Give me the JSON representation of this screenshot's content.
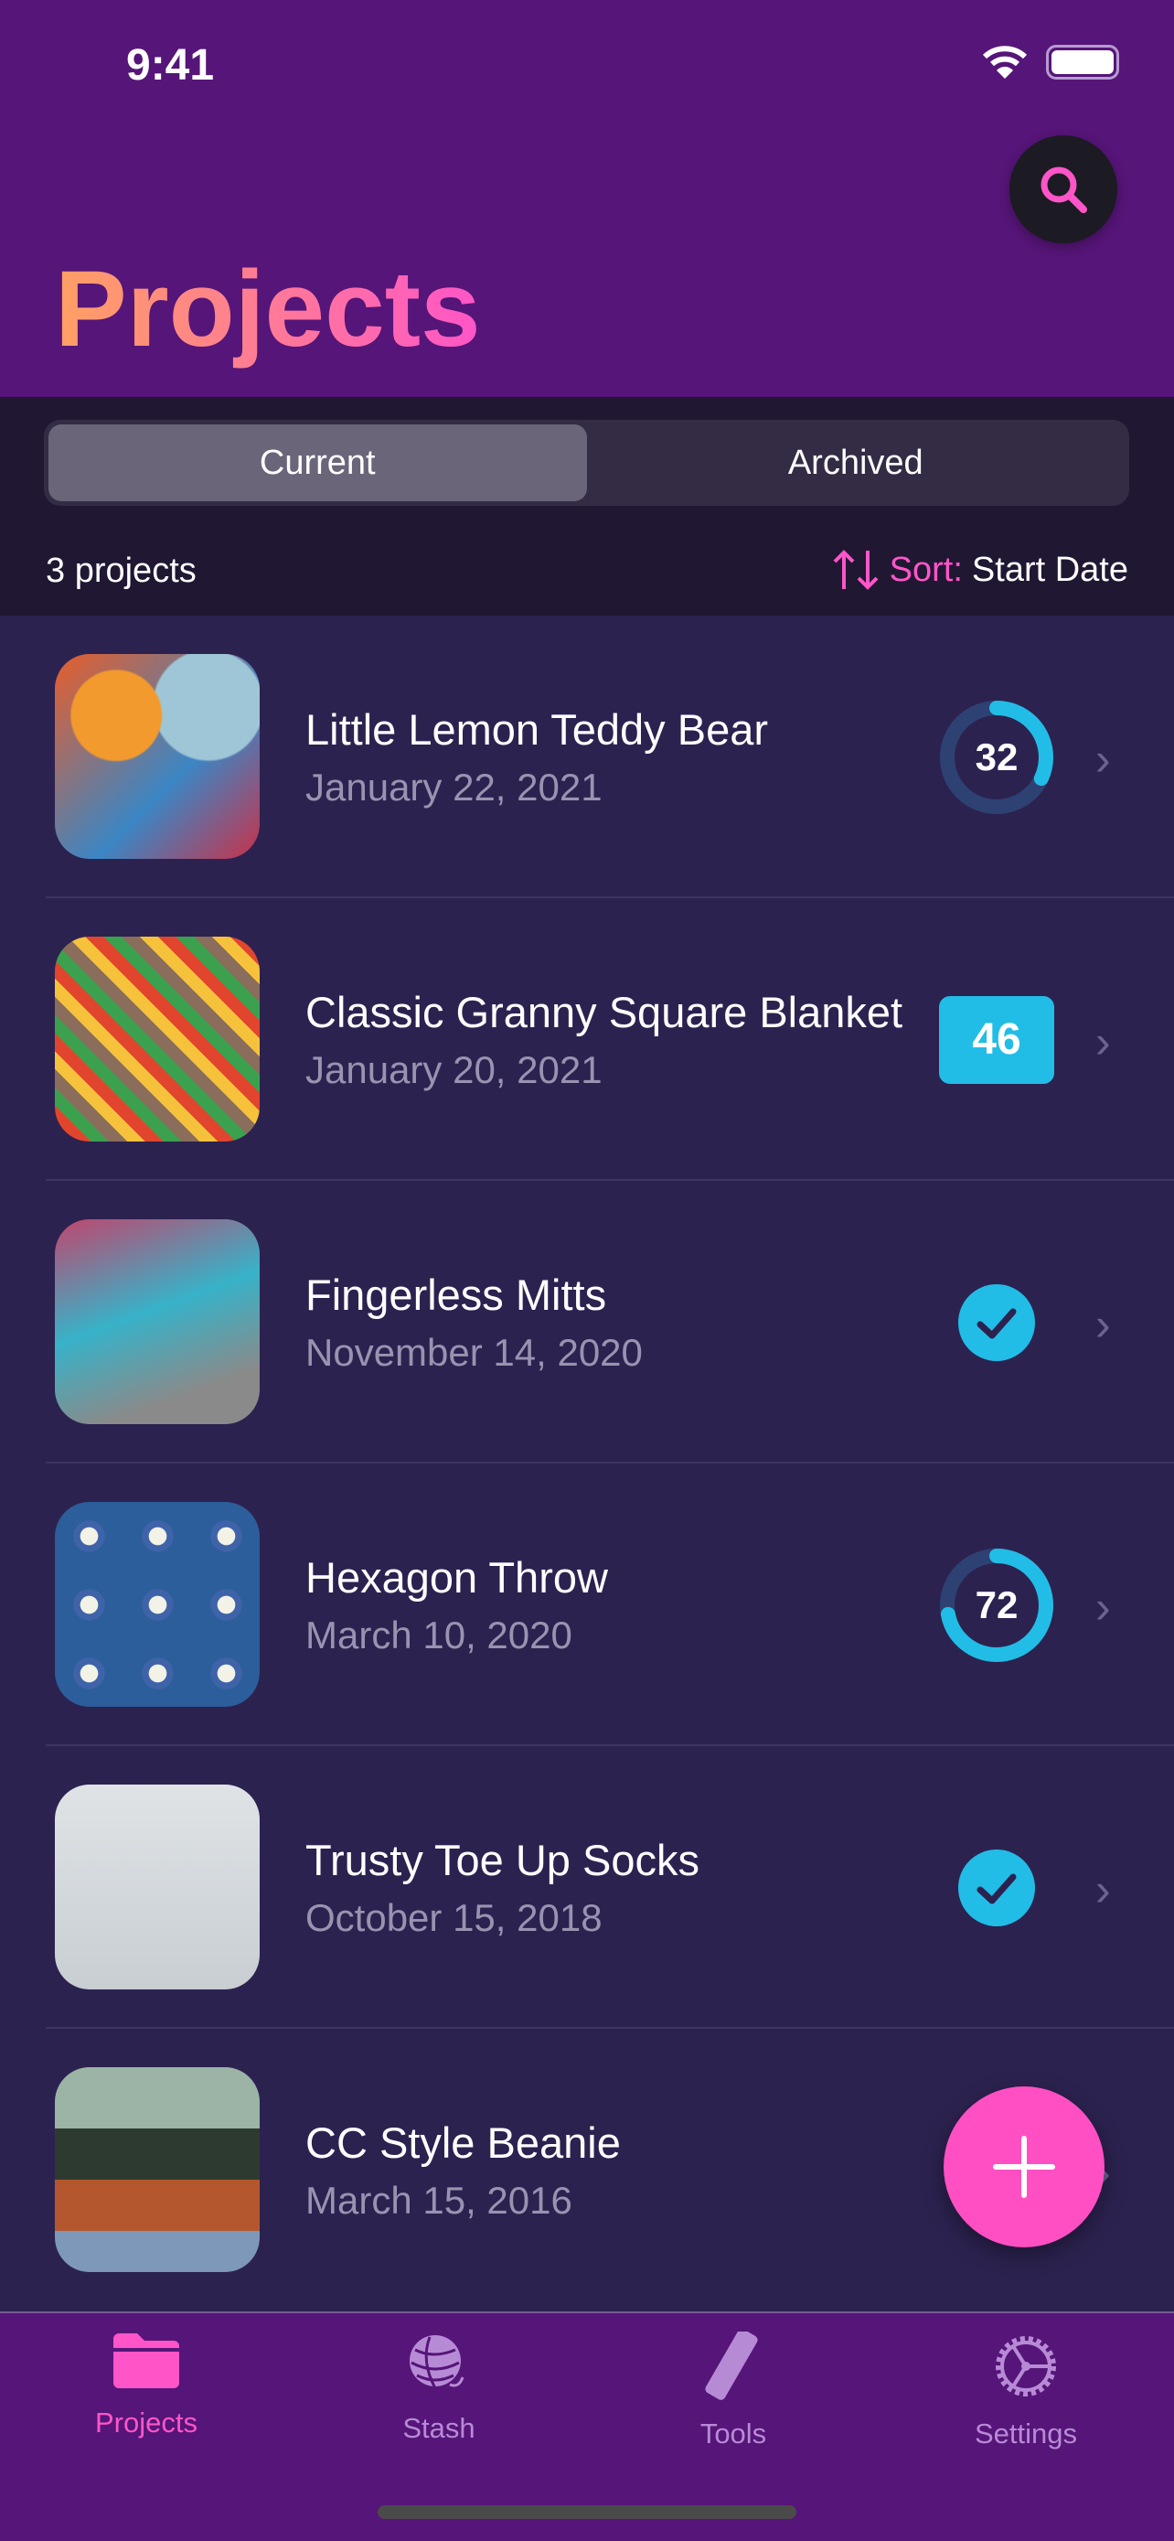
{
  "status": {
    "time": "9:41"
  },
  "header": {
    "title": "Projects",
    "search_icon": "magnifying-glass-icon"
  },
  "segments": {
    "current": "Current",
    "archived": "Archived",
    "selected": "Current"
  },
  "summary": {
    "count": "3 projects",
    "sort_label": "Sort:",
    "sort_value": "Start Date"
  },
  "colors": {
    "header": "#561578",
    "accent": "#ff55c8",
    "progress": "#21bde6",
    "list_bg": "#2c2250"
  },
  "projects": [
    {
      "name": "Little Lemon Teddy Bear",
      "date": "January 22, 2021",
      "status": "ring",
      "value": "32",
      "progress": 32
    },
    {
      "name": "Classic Granny Square Blanket",
      "date": "January 20, 2021",
      "status": "box",
      "value": "46"
    },
    {
      "name": "Fingerless Mitts",
      "date": "November 14, 2020",
      "status": "done"
    },
    {
      "name": "Hexagon Throw",
      "date": "March 10, 2020",
      "status": "ring",
      "value": "72",
      "progress": 72
    },
    {
      "name": "Trusty Toe Up Socks",
      "date": "October 15, 2018",
      "status": "done"
    },
    {
      "name": "CC Style Beanie",
      "date": "March 15, 2016",
      "status": "none"
    }
  ],
  "tabs": [
    {
      "label": "Projects",
      "icon": "folder-icon"
    },
    {
      "label": "Stash",
      "icon": "yarn-ball-icon"
    },
    {
      "label": "Tools",
      "icon": "ruler-icon"
    },
    {
      "label": "Settings",
      "icon": "gear-icon"
    }
  ]
}
